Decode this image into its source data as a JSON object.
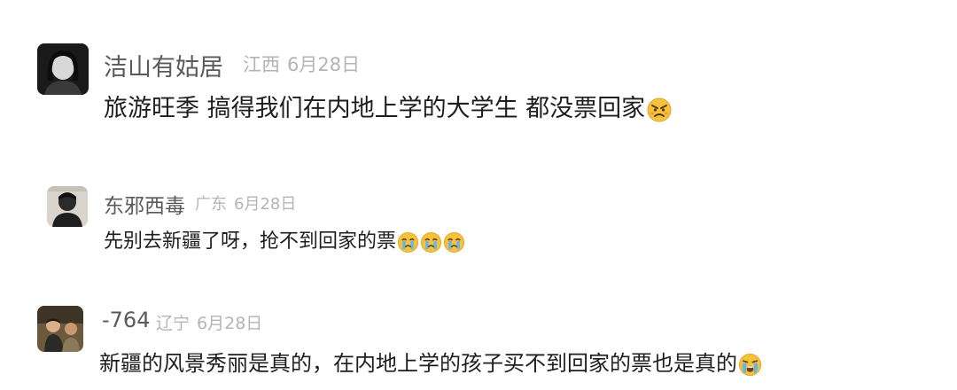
{
  "comments": [
    {
      "username": "洁山有姑居",
      "location": "江西",
      "date": "6月28日",
      "text": "旅游旺季 搞得我们在内地上学的大学生 都没票回家",
      "emojis": [
        "angry-face"
      ]
    },
    {
      "username": "东邪西毒",
      "location": "广东",
      "date": "6月28日",
      "text": "先别去新疆了呀，抢不到回家的票",
      "emojis": [
        "crying-face",
        "crying-face",
        "crying-face"
      ]
    },
    {
      "username": "-764",
      "location": "辽宁",
      "date": "6月28日",
      "text": "新疆的风景秀丽是真的，在内地上学的孩子买不到回家的票也是真的",
      "emojis": [
        "loudly-crying-face"
      ]
    }
  ],
  "colors": {
    "username": "#5a5a5a",
    "meta": "#b4b4b4",
    "text": "#1e1e1e",
    "emoji_yellow": "#f7c23b"
  }
}
